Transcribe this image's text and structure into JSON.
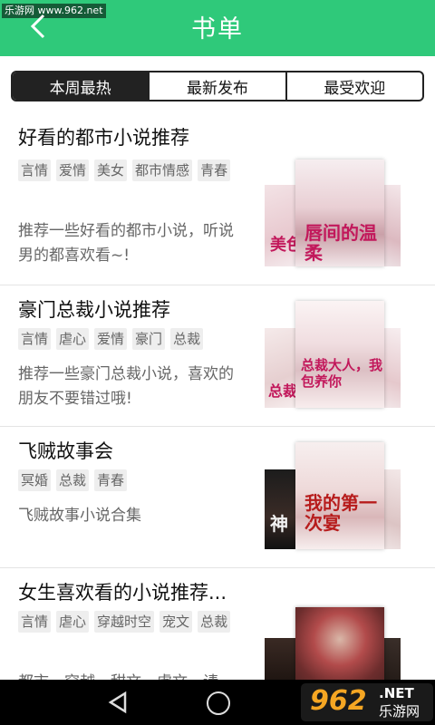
{
  "header": {
    "title": "书单",
    "watermark": "乐游网 www.962.net",
    "bg_color": "#2fc97a"
  },
  "tabs": [
    {
      "label": "本周最热",
      "selected": true
    },
    {
      "label": "最新发布",
      "selected": false
    },
    {
      "label": "最受欢迎",
      "selected": false
    }
  ],
  "booklists": [
    {
      "title": "好看的都市小说推荐",
      "tags": [
        "言情",
        "爱情",
        "美女",
        "都市情感",
        "青春"
      ],
      "description": "推荐一些好看的都市小说，听说男的都喜欢看~!",
      "covers": [
        "美色",
        "唇间的温柔"
      ]
    },
    {
      "title": "豪门总裁小说推荐",
      "tags": [
        "言情",
        "虐心",
        "爱情",
        "豪门",
        "总裁"
      ],
      "description": "推荐一些豪门总裁小说，喜欢的朋友不要错过哦!",
      "covers": [
        "总裁",
        "总裁大人，我包养你"
      ]
    },
    {
      "title": "飞贼故事会",
      "tags": [
        "冥婚",
        "总裁",
        "青春"
      ],
      "description": "飞贼故事小说合集",
      "covers": [
        "神",
        "我的第一次宴"
      ]
    },
    {
      "title": "女生喜欢看的小说推荐...",
      "tags": [
        "言情",
        "虐心",
        "穿越时空",
        "宠文",
        "总裁"
      ],
      "description": "都市，穿越，甜文，虐文，请",
      "covers": [
        "",
        ""
      ]
    }
  ],
  "watermark_bottom": {
    "number": "962",
    "domain": ".NET",
    "name": "乐游网"
  }
}
